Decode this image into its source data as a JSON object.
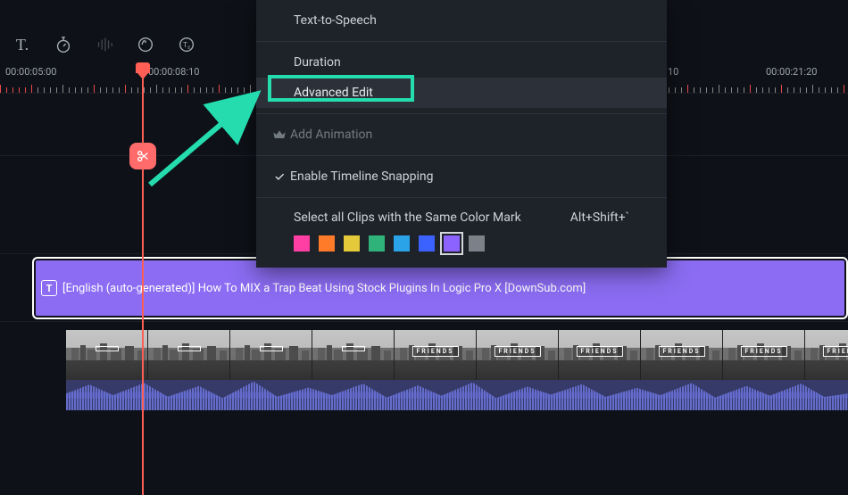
{
  "toolbar": {
    "icons": [
      "text-tool",
      "stopwatch",
      "audio-bars",
      "speed-circle",
      "text-circle"
    ]
  },
  "ruler": {
    "times": [
      "00:00:05:00",
      "00:00:08:10",
      "00:00:21:20"
    ],
    "overflow_symbol": "10"
  },
  "context_menu": {
    "tts_label": "Text-to-Speech",
    "duration_label": "Duration",
    "advanced_label": "Advanced Edit",
    "add_anim_label": "Add Animation",
    "snap_label": "Enable Timeline Snapping",
    "colormark_label": "Select all Clips with the Same Color Mark",
    "colormark_shortcut": "Alt+Shift+`",
    "swatches": [
      "#ff3fa4",
      "#ff7a29",
      "#e4c93a",
      "#2fb37a",
      "#2aa3e8",
      "#3b62ff",
      "#8c63ff",
      "#7c8088"
    ],
    "selected_swatch_index": 6
  },
  "subtitle_clip": {
    "badge": "T",
    "label": "[English (auto-generated)] How To MIX a Trap Beat Using Stock Plugins In Logic Pro X [DownSub.com]"
  },
  "video_clip": {
    "thumb_overlay": "FRIENDS",
    "thumbs": [
      "box",
      "box",
      "box",
      "box",
      "friends",
      "friends",
      "friends",
      "friends",
      "friends",
      "friends"
    ]
  },
  "playhead": {
    "time": "00:00:08:10"
  }
}
